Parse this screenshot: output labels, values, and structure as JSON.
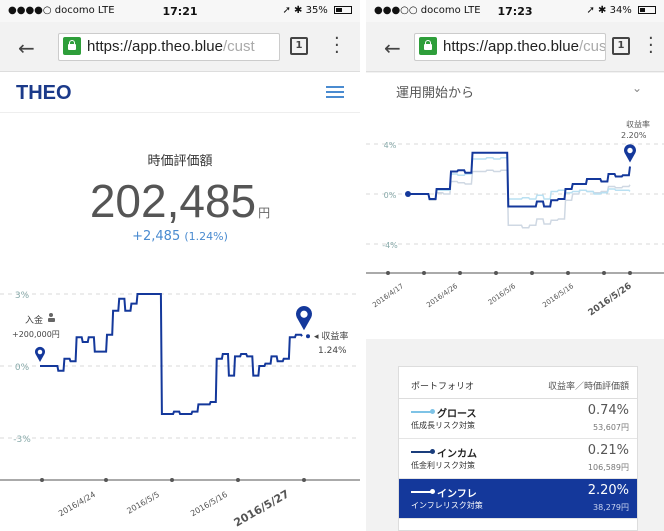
{
  "phone_a": {
    "status": {
      "carrier": "●●●●○ docomo  LTE",
      "time": "17:21",
      "right": "➚ ✱ 35%",
      "battery": 0.35
    },
    "browser": {
      "url_host": "https://app.theo.blue",
      "url_path": "/cust",
      "tab_count": "1"
    },
    "header": {
      "logo": "THEO"
    },
    "summary": {
      "label": "時価評価額",
      "amount": "202,485",
      "unit": "円",
      "change": "+2,485",
      "change_pct": "(1.24%)"
    },
    "chart": {
      "y_ticks": [
        "3%",
        "0%",
        "-3%"
      ],
      "x_ticks": [
        "2016/4/24",
        "2016/5/5",
        "2016/5/16",
        "2016/5/27"
      ],
      "deposit_label": "入金",
      "deposit_icon": "hand-coin-icon",
      "deposit_amount": "+200,000円",
      "return_label": "収益率",
      "return_value": "1.24%"
    }
  },
  "phone_b": {
    "status": {
      "carrier": "●●●○○ docomo  LTE",
      "time": "17:23",
      "right": "➚ ✱ 34%",
      "battery": 0.34
    },
    "browser": {
      "url_host": "https://app.theo.blue",
      "url_path": "/cus",
      "tab_count": "1"
    },
    "period": {
      "label": "運用開始から"
    },
    "chart": {
      "y_ticks": [
        "4%",
        "0%",
        "-4%"
      ],
      "x_ticks": [
        "2016/4/17",
        "2016/4/26",
        "2016/5/6",
        "2016/5/16",
        "2016/5/26"
      ],
      "return_label": "収益率",
      "return_value": "2.20%"
    },
    "portfolio": {
      "col_left": "ポートフォリオ",
      "col_right": "収益率／時価評価額",
      "rows": [
        {
          "name": "グロース",
          "sub": "低成長リスク対策",
          "pct": "0.74%",
          "amount": "53,607円",
          "color": "#7ec3e6"
        },
        {
          "name": "インカム",
          "sub": "低金利リスク対策",
          "pct": "0.21%",
          "amount": "106,589円",
          "color": "#1a3d7c"
        },
        {
          "name": "インフレ",
          "sub": "インフレリスク対策",
          "pct": "2.20%",
          "amount": "38,279円",
          "color": "#ffffff"
        }
      ]
    }
  },
  "chart_data": [
    {
      "type": "line",
      "title": "",
      "x_ticks": [
        "2016/4/24",
        "2016/5/5",
        "2016/5/16",
        "2016/5/27"
      ],
      "ylim": [
        -5,
        3.5
      ],
      "yticks": [
        3,
        0,
        -3
      ],
      "grid": true,
      "series": [
        {
          "values": [
            0,
            0,
            0,
            -0.2,
            0.3,
            0.2,
            1.2,
            1.0,
            1.2,
            0.6,
            0.6,
            1.3,
            2.3,
            2.8,
            2.3,
            2.6,
            3.0,
            3.0,
            3.0,
            3.0,
            -2.0,
            -2.0,
            -1.9,
            -2.0,
            -2.0,
            -1.9,
            -1.6,
            -1.6,
            -1.5,
            0.3,
            0.5,
            -0.4,
            0.4,
            0.5,
            0.4,
            -0.4,
            0.0,
            0.1,
            0.4,
            0.2,
            0.3,
            1.2,
            1.3,
            1.24
          ]
        }
      ]
    },
    {
      "type": "line",
      "title": "",
      "x_ticks": [
        "2016/4/17",
        "2016/4/26",
        "2016/5/6",
        "2016/5/16",
        "2016/5/26"
      ],
      "ylim": [
        -5,
        5
      ],
      "yticks": [
        4,
        0,
        -4
      ],
      "grid": true,
      "series": [
        {
          "values": [
            0,
            0,
            0,
            -0.4,
            0.4,
            0.4,
            1.8,
            1.9,
            1.7,
            3.3,
            3.3,
            3.3,
            3.3,
            3.3,
            -1.0,
            -1.0,
            -1.0,
            -1.0,
            -0.6,
            -1.0,
            -0.5,
            -0.4,
            0.4,
            0.8,
            0.8,
            1.2,
            1.2,
            1.0,
            1.6,
            1.4,
            1.5,
            2.2
          ]
        },
        {
          "values": [
            0,
            0,
            0,
            -0.4,
            0.3,
            0.3,
            1.6,
            1.5,
            1.6,
            2.8,
            2.8,
            2.9,
            2.8,
            2.9,
            -0.4,
            -0.4,
            -0.3,
            -0.4,
            -0.1,
            -0.4,
            0.2,
            0.3,
            0.1,
            0.2,
            0.3,
            0.2,
            0.0,
            0.1,
            0.4,
            0.3,
            0.3,
            0.21
          ]
        },
        {
          "values": [
            0,
            0,
            0,
            -0.5,
            0.1,
            0.0,
            1.0,
            0.9,
            0.8,
            1.8,
            1.8,
            1.9,
            1.8,
            1.9,
            -2.5,
            -2.5,
            -2.7,
            -2.5,
            -2.0,
            -2.4,
            -2.1,
            -2.0,
            -0.5,
            0.0,
            0.3,
            0.2,
            0.1,
            0.2,
            0.6,
            0.5,
            0.6,
            0.74
          ]
        }
      ]
    }
  ]
}
